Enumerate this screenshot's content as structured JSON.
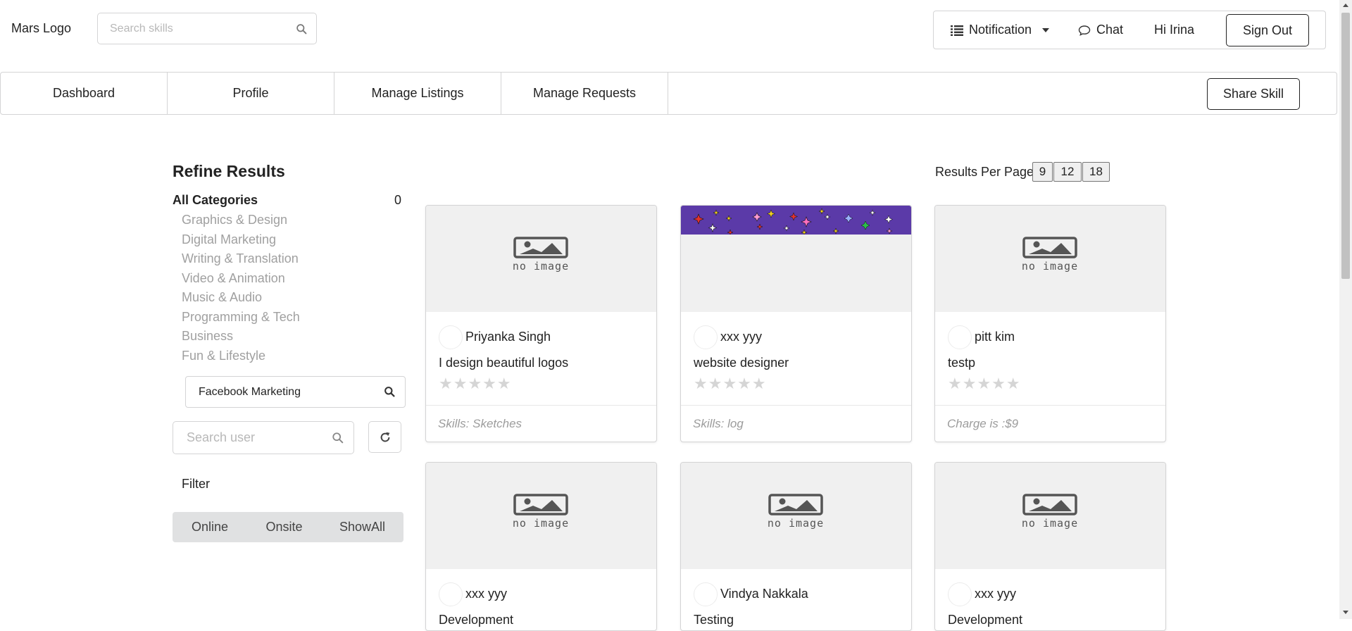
{
  "header": {
    "logo": "Mars Logo",
    "search_placeholder": "Search skills",
    "notification_label": "Notification",
    "chat_label": "Chat",
    "greeting": "Hi Irina",
    "signout_label": "Sign Out"
  },
  "nav": {
    "tabs": [
      "Dashboard",
      "Profile",
      "Manage Listings",
      "Manage Requests"
    ],
    "share_label": "Share Skill"
  },
  "sidebar": {
    "title": "Refine Results",
    "all_categories": "All Categories",
    "all_count": "0",
    "categories": [
      "Graphics & Design",
      "Digital Marketing",
      "Writing & Translation",
      "Video & Animation",
      "Music & Audio",
      "Programming & Tech",
      "Business",
      "Fun & Lifestyle"
    ],
    "subcategory": "Facebook Marketing",
    "search_user_placeholder": "Search user",
    "filter_label": "Filter",
    "filters": [
      "Online",
      "Onsite",
      "ShowAll"
    ]
  },
  "results_per_page": {
    "label": "Results Per Page :",
    "options": [
      "9",
      "12",
      "18"
    ]
  },
  "no_image_text": "no image",
  "cards": [
    {
      "user": "Priyanka Singh",
      "title": "I design beautiful logos",
      "footer": "Skills: Sketches",
      "image": "no-image",
      "rating": 0
    },
    {
      "user": "xxx yyy",
      "title": "website designer",
      "footer": "Skills: log",
      "image": "sparkle-banner",
      "rating": 0
    },
    {
      "user": "pitt kim",
      "title": "testp",
      "footer": "Charge is :$9",
      "image": "no-image",
      "rating": 0
    },
    {
      "user": "xxx yyy",
      "title": "Development",
      "footer": "",
      "image": "no-image",
      "rating": 0
    },
    {
      "user": "Vindya Nakkala",
      "title": "Testing",
      "footer": "",
      "image": "no-image",
      "rating": 0
    },
    {
      "user": "xxx yyy",
      "title": "Development",
      "footer": "",
      "image": "no-image",
      "rating": 0
    }
  ],
  "colors": {
    "border": "#d4d4d5",
    "muted_text": "#a0a0a0",
    "banner_purple": "#5b3aa8",
    "filter_bg": "#e0e1e2",
    "star": "#d5d5d5"
  }
}
